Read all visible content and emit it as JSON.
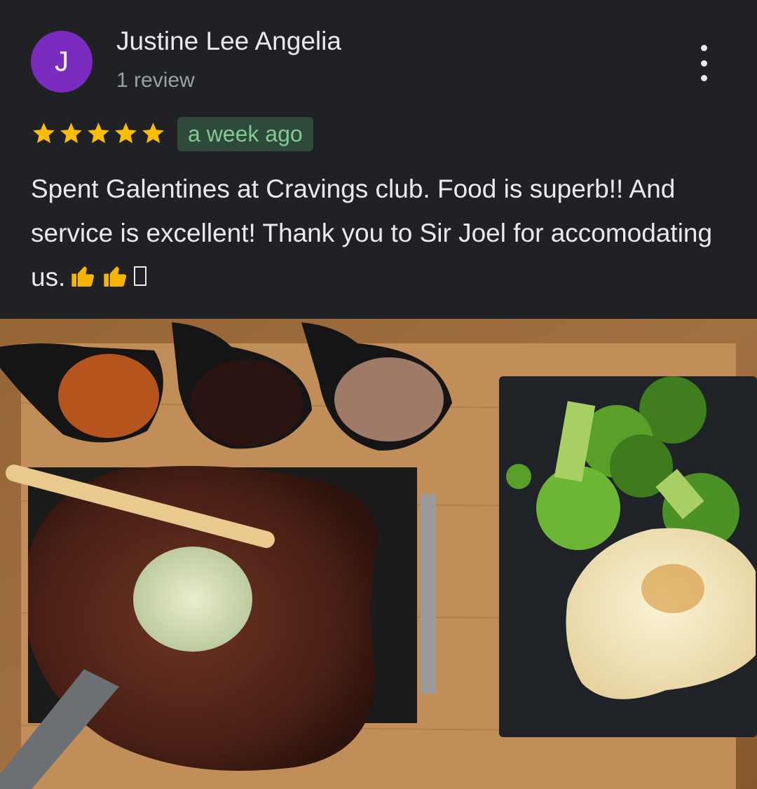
{
  "review": {
    "avatar_initial": "J",
    "avatar_color": "#7b2cbf",
    "author": "Justine Lee Angelia",
    "review_count": "1 review",
    "rating": 5,
    "date": "a week ago",
    "text": "Spent Galentines at Cravings club. Food is superb!! And service is excellent! Thank you to Sir Joel for accomodating us."
  },
  "icons": {
    "more": "more-vert-icon",
    "star": "star-icon"
  },
  "colors": {
    "background": "#202124",
    "star": "#fbbc04",
    "date_badge_bg": "#2d4a3a",
    "date_badge_text": "#81c995"
  }
}
